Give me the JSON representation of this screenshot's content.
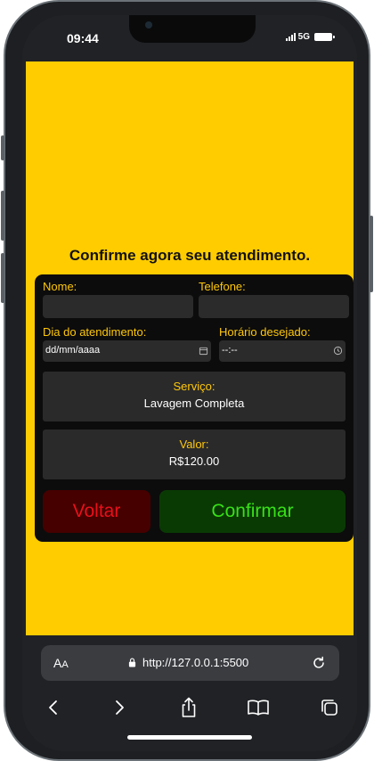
{
  "status_bar": {
    "time": "09:44",
    "network": "5G"
  },
  "page": {
    "title": "Confirme agora seu atendimento.",
    "background_color": "#ffcc00"
  },
  "form": {
    "name_label": "Nome:",
    "name_value": "",
    "phone_label": "Telefone:",
    "phone_value": "",
    "date_label": "Dia do atendimento:",
    "date_placeholder": "dd/mm/aaaa",
    "time_label": "Horário desejado:",
    "time_placeholder": "--:--",
    "service_label": "Serviço:",
    "service_value": "Lavagem Completa",
    "price_label": "Valor:",
    "price_value": "R$120.00"
  },
  "buttons": {
    "back_label": "Voltar",
    "confirm_label": "Confirmar"
  },
  "browser": {
    "text_size_label_large": "A",
    "text_size_label_small": "A",
    "url": "http://127.0.0.1:5500",
    "icons": [
      "lock-icon",
      "reload-icon",
      "back-icon",
      "forward-icon",
      "share-icon",
      "bookmarks-icon",
      "tabs-icon"
    ]
  },
  "colors": {
    "accent_label": "#ffc80a",
    "back_button_bg": "#460000",
    "back_button_text": "#e8101a",
    "confirm_button_bg": "#0a3a04",
    "confirm_button_text": "#38e018"
  }
}
